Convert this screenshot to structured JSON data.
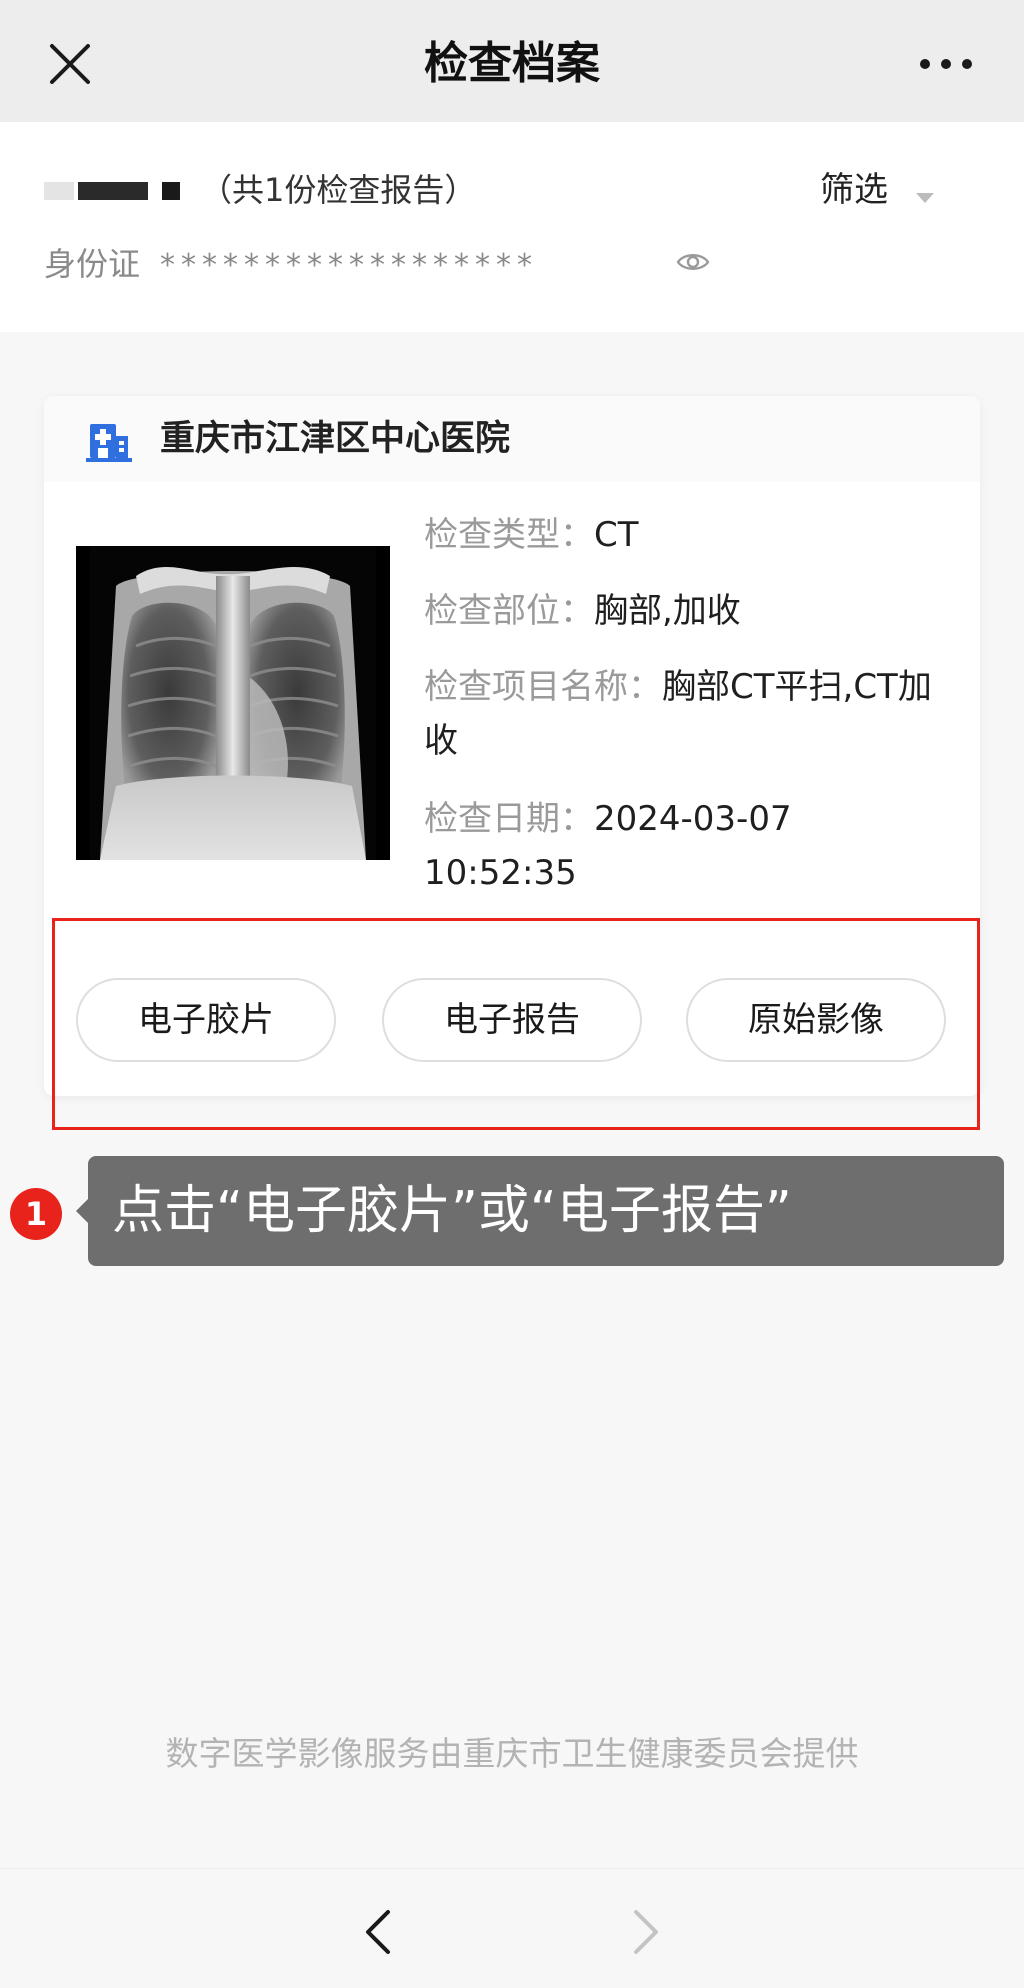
{
  "nav": {
    "title": "检查档案",
    "close_icon": "close-icon",
    "more_icon": "more-icon"
  },
  "patient": {
    "report_count_text": "（共1份检查报告）",
    "filter_label": "筛选",
    "id_label": "身份证",
    "id_masked": "******************",
    "eye_icon": "eye-icon"
  },
  "card": {
    "hospital_name": "重庆市江津区中心医院",
    "hospital_icon": "hospital-icon",
    "thumbnail": "chest-xray-thumbnail",
    "fields": [
      {
        "key": "检查类型：",
        "value": "CT"
      },
      {
        "key": "检查部位：",
        "value": "胸部,加收"
      },
      {
        "key": "检查项目名称：",
        "value": "胸部CT平扫,CT加收"
      },
      {
        "key": "检查日期：",
        "value": "2024-03-07 10:52:35"
      }
    ],
    "buttons": [
      {
        "label": "电子胶片"
      },
      {
        "label": "电子报告"
      },
      {
        "label": "原始影像"
      }
    ]
  },
  "annotation": {
    "step_number": "1",
    "tip_text": "点击“电子胶片”或“电子报告”",
    "highlight_color": "#e8231b"
  },
  "footer": {
    "provider_text": "数字医学影像服务由重庆市卫生健康委员会提供"
  },
  "bottom_nav": {
    "back_icon": "chevron-left-icon",
    "forward_icon": "chevron-right-icon"
  }
}
